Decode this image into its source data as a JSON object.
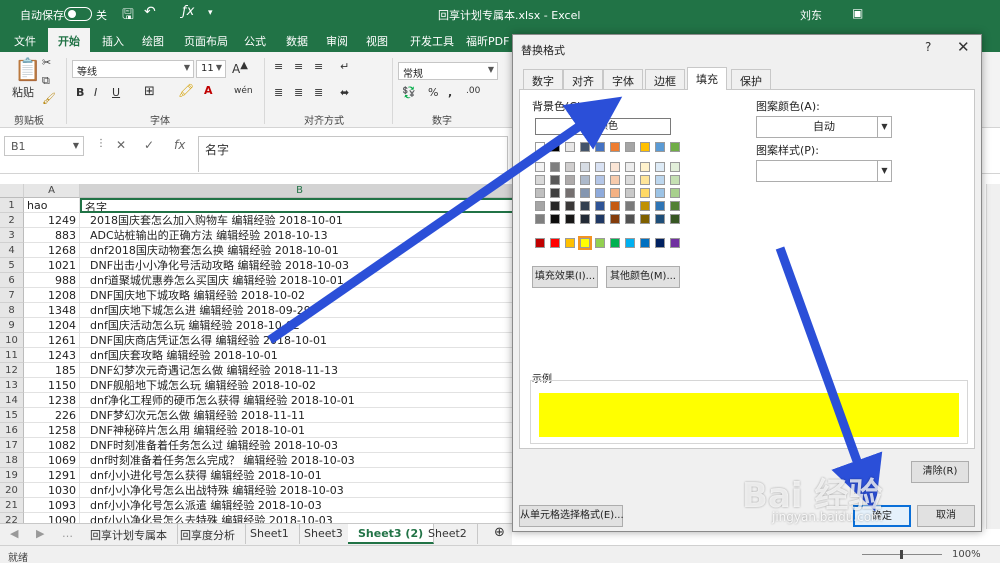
{
  "titlebar": {
    "autosave": "自动保存",
    "autosave_state": "关",
    "filename": "回享计划专属本.xlsx",
    "app": "Excel",
    "user": "刘东",
    "brand_color": "#217346"
  },
  "ribbon_tabs": [
    "文件",
    "开始",
    "插入",
    "绘图",
    "页面布局",
    "公式",
    "数据",
    "审阅",
    "视图",
    "开发工具",
    "福昕PDF"
  ],
  "ribbon": {
    "paste": "粘贴",
    "clipboard": "剪贴板",
    "font_name": "等线",
    "font_size": "11",
    "font_group": "字体",
    "align_group": "对齐方式",
    "number_format": "常规",
    "number_group": "数字"
  },
  "formula": {
    "namebox": "B1",
    "fx": "fx",
    "value": "名字"
  },
  "grid": {
    "col_a": "A",
    "col_b": "B",
    "row_numbers": [
      "1",
      "2",
      "3",
      "4",
      "5",
      "6",
      "7",
      "8",
      "9",
      "10",
      "11",
      "12",
      "13",
      "14",
      "15",
      "16",
      "17",
      "18",
      "19",
      "20",
      "21",
      "22"
    ],
    "header_a": "hao",
    "header_b": "名字",
    "rows": [
      [
        "1249",
        "2018国庆套怎么加入购物车 编辑经验 2018-10-01"
      ],
      [
        "883",
        "ADC站桩输出的正确方法 编辑经验 2018-10-13"
      ],
      [
        "1268",
        "dnf2018国庆动物套怎么换 编辑经验 2018-10-01"
      ],
      [
        "1021",
        "DNF出击小小净化号活动攻略 编辑经验 2018-10-03"
      ],
      [
        "988",
        "dnf道聚城优惠券怎么买国庆 编辑经验 2018-10-01"
      ],
      [
        "1208",
        "DNF国庆地下城攻略 编辑经验 2018-10-02"
      ],
      [
        "1348",
        "dnf国庆地下城怎么进 编辑经验 2018-09-29"
      ],
      [
        "1204",
        "dnf国庆活动怎么玩 编辑经验 2018-10-02"
      ],
      [
        "1261",
        "DNF国庆商店凭证怎么得 编辑经验 2018-10-01"
      ],
      [
        "1243",
        "dnf国庆套攻略 编辑经验 2018-10-01"
      ],
      [
        "185",
        "DNF幻梦次元奇遇记怎么做 编辑经验 2018-11-13"
      ],
      [
        "1150",
        "DNF舰船地下城怎么玩 编辑经验 2018-10-02"
      ],
      [
        "1238",
        "dnf净化工程师的硬币怎么获得 编辑经验 2018-10-01"
      ],
      [
        "226",
        "DNF梦幻次元怎么做 编辑经验 2018-11-11"
      ],
      [
        "1258",
        "DNF神秘碎片怎么用 编辑经验 2018-10-01"
      ],
      [
        "1082",
        "DNF时刻准备着任务怎么过 编辑经验 2018-10-03"
      ],
      [
        "1069",
        "dnf时刻准备着任务怎么完成？ 编辑经验 2018-10-03"
      ],
      [
        "1291",
        "dnf小小进化号怎么获得 编辑经验 2018-10-01"
      ],
      [
        "1030",
        "dnf小小净化号怎么出战特殊 编辑经验 2018-10-03"
      ],
      [
        "1093",
        "dnf小小净化号怎么派遣 编辑经验 2018-10-03"
      ],
      [
        "1090",
        "dnf小小净化号怎么去特殊 编辑经验 2018-10-03"
      ]
    ]
  },
  "sheet_tabs": [
    "回享计划专属本",
    "回享度分析",
    "Sheet1",
    "Sheet3",
    "Sheet3 (2)",
    "Sheet2"
  ],
  "status": {
    "ready": "就绪",
    "zoom": "100%"
  },
  "dialog": {
    "title": "替换格式",
    "help": "?",
    "close": "✕",
    "tabs": [
      "数字",
      "对齐",
      "字体",
      "边框",
      "填充",
      "保护"
    ],
    "bg_label": "背景色(C):",
    "no_color": "无颜色",
    "fill_effects": "填充效果(I)...",
    "more_colors": "其他颜色(M)...",
    "pattern_color_label": "图案颜色(A):",
    "pattern_color_value": "自动",
    "pattern_style_label": "图案样式(P):",
    "sample_label": "示例",
    "sample_color": "#ffff00",
    "clear": "清除(R)",
    "choose_from_cell": "从单元格选择格式(E)...",
    "ok": "确定",
    "cancel": "取消"
  },
  "watermark": {
    "text": "Bai 经验",
    "sub": "jingyan.baidu.com"
  }
}
